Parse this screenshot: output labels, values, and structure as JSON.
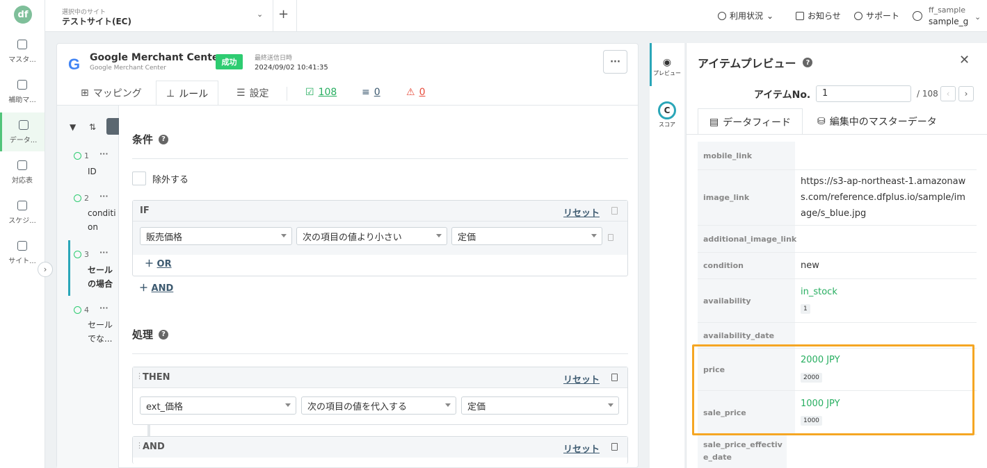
{
  "nav": {
    "items": [
      {
        "label": "マスタ..."
      },
      {
        "label": "補助マ..."
      },
      {
        "label": "データ..."
      },
      {
        "label": "対応表"
      },
      {
        "label": "スケジ..."
      },
      {
        "label": "サイト..."
      }
    ]
  },
  "header": {
    "site_label": "選択中のサイト",
    "site_name": "テストサイト(EC)",
    "usage": "利用状況",
    "notice": "お知らせ",
    "support": "サポート",
    "user_top": "ff_sample",
    "user_bottom": "sample_g"
  },
  "feed": {
    "name": "Google Merchant Center",
    "sub": "Google Merchant Center",
    "status": "成功",
    "last_sent_label": "最終送信日時",
    "last_sent": "2024/09/02 10:41:35",
    "more": "···"
  },
  "tabs": {
    "mapping": "マッピング",
    "rule": "ルール",
    "settings": "設定",
    "ok_count": "108",
    "warn_count": "0",
    "err_count": "0"
  },
  "rules": [
    {
      "num": "1",
      "name": "ID"
    },
    {
      "num": "2",
      "name": "condition"
    },
    {
      "num": "3",
      "name": "セールの場合"
    },
    {
      "num": "4",
      "name": "セールでな..."
    }
  ],
  "condition": {
    "title": "条件",
    "exclude": "除外する",
    "if_label": "IF",
    "reset": "リセット",
    "field": "販売価格",
    "op": "次の項目の値より小さい",
    "target": "定価",
    "or": "OR",
    "and": "AND"
  },
  "process": {
    "title": "処理",
    "then_label": "THEN",
    "reset": "リセット",
    "field": "ext_価格",
    "op": "次の項目の値を代入する",
    "target": "定価",
    "and_label": "AND"
  },
  "strip": {
    "preview": "プレビュー",
    "score": "スコア"
  },
  "preview": {
    "title": "アイテムプレビュー",
    "item_no_label": "アイテムNo.",
    "item_no": "1",
    "total": "/ 108",
    "tab_feed": "データフィード",
    "tab_master": "編集中のマスターデータ",
    "rows": [
      {
        "key": "mobile_link",
        "value": ""
      },
      {
        "key": "image_link",
        "value": "https://s3-ap-northeast-1.amazonaws.com/reference.dfplus.io/sample/image/s_blue.jpg"
      },
      {
        "key": "additional_image_link",
        "value": ""
      },
      {
        "key": "condition",
        "value": "new"
      },
      {
        "key": "availability",
        "value": "in_stock",
        "tag": "1"
      },
      {
        "key": "availability_date",
        "value": ""
      },
      {
        "key": "price",
        "value": "2000 JPY",
        "tag": "2000"
      },
      {
        "key": "sale_price",
        "value": "1000 JPY",
        "tag": "1000"
      },
      {
        "key": "sale_price_effective_date",
        "value": ""
      }
    ]
  }
}
